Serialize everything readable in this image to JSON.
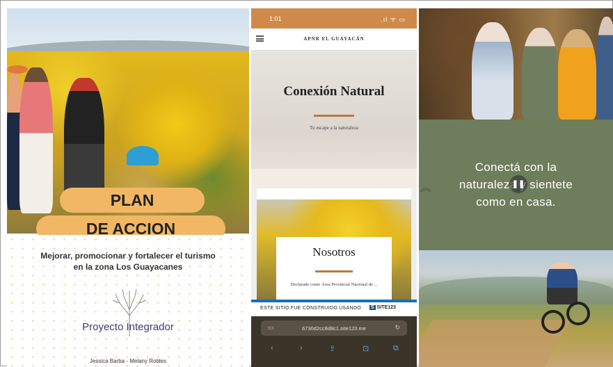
{
  "left_panel": {
    "plan_line1": "PLAN",
    "plan_line2": "DE ACCION",
    "description": "Mejorar, promocionar y fortalecer el turismo en la zona Los Guayacanes",
    "project": "Proyecto Integrador",
    "authors": "Jessica Barba - Melany Robles"
  },
  "phone": {
    "status_time": "1:01",
    "status_icons": ".ıl ᯤ ▭",
    "brand": "APNR EL GUAYACÁN",
    "hero_title": "Conexión Natural",
    "hero_subtitle": "Tu escape a la naturaleza",
    "section_title": "Nosotros",
    "section_text": "Declarado como Área Provincial Nacional de ...",
    "site_notice": "ESTE SITIO FUE CONSTRUIDO USANDO",
    "site_logo": "SITE123",
    "url": "6730d2cc8d8c1.site123.me"
  },
  "right_panel": {
    "tagline_line1": "Conectá con la",
    "tagline_line2": "naturaleza y sientete",
    "tagline_line3": "como en casa."
  },
  "colors": {
    "accent_orange": "#f2b764",
    "status_bar": "#cf8a4b",
    "olive": "#6e7d5b",
    "divider_brown": "#b97a3b"
  }
}
